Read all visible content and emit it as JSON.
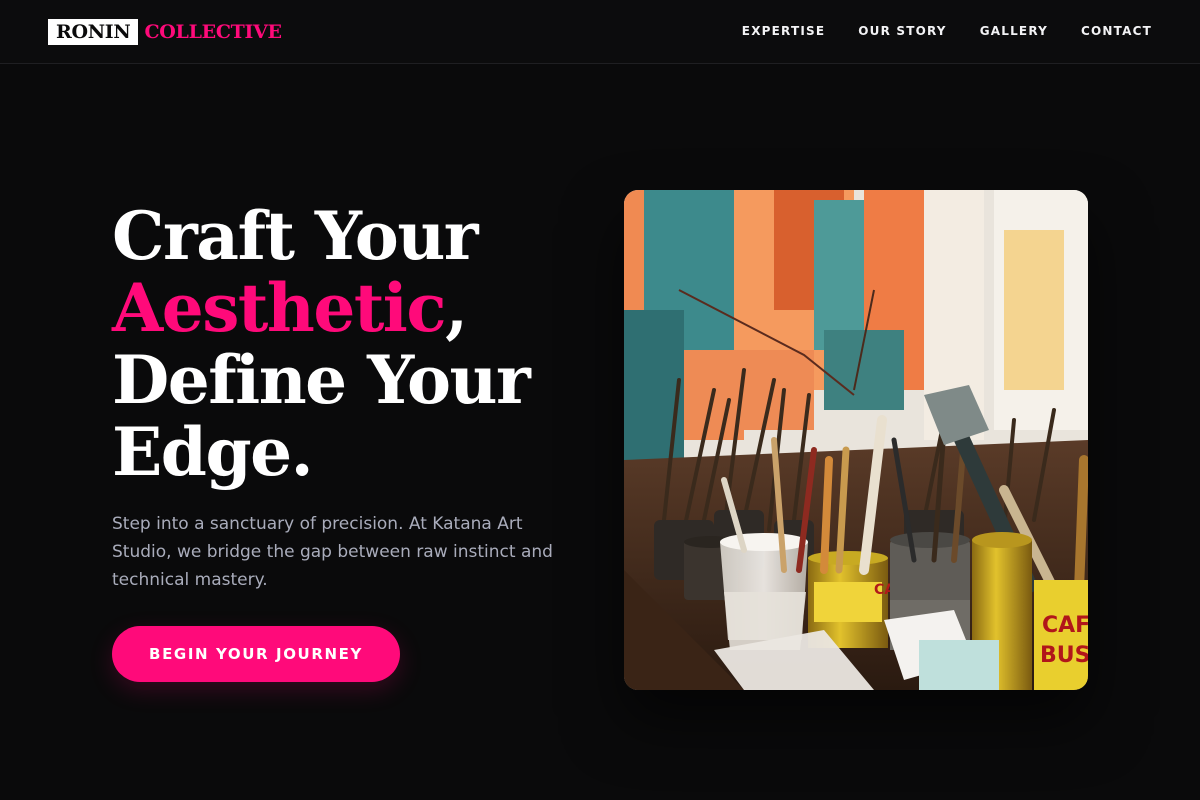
{
  "brand": {
    "name_primary": "RONIN",
    "name_secondary": "COLLECTIVE",
    "accent_color": "#ff0a7a"
  },
  "nav": {
    "items": [
      {
        "label": "EXPERTISE"
      },
      {
        "label": "OUR STORY"
      },
      {
        "label": "GALLERY"
      },
      {
        "label": "CONTACT"
      }
    ]
  },
  "hero": {
    "title_line1": "Craft Your",
    "title_accent": "Aesthetic",
    "title_comma": ",",
    "title_line3": "Define Your",
    "title_line4": "Edge.",
    "description": "Step into a sanctuary of precision. At Katana Art Studio, we bridge the gap between raw instinct and technical mastery.",
    "cta_label": "BEGIN YOUR JOURNEY"
  },
  "image": {
    "subject": "art studio table with paint brushes in cans"
  },
  "colors": {
    "background": "#0a0a0b",
    "text": "#ffffff",
    "muted_text": "#a9acbb",
    "accent": "#ff0a7a"
  }
}
